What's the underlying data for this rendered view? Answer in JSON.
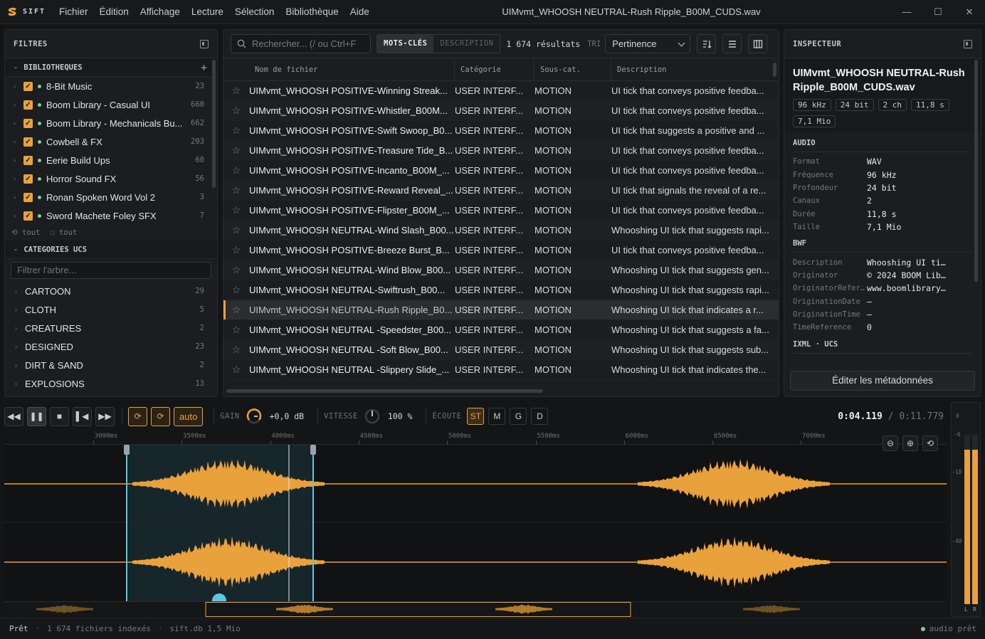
{
  "app": {
    "logo_text": "SIFT",
    "window_title": "UIMvmt_WHOOSH NEUTRAL-Rush Ripple_B00M_CUDS.wav",
    "accent": "#e9a13b"
  },
  "menus": [
    "Fichier",
    "Édition",
    "Affichage",
    "Lecture",
    "Sélection",
    "Bibliothèque",
    "Aide"
  ],
  "window_controls": {
    "minimize": "—",
    "maximize": "☐",
    "close": "✕"
  },
  "filters": {
    "title": "FILTRES",
    "libraries_title": "BIBLIOTHEQUES",
    "libraries": [
      {
        "name": "8-Bit Music",
        "count": "23"
      },
      {
        "name": "Boom Library - Casual UI",
        "count": "660"
      },
      {
        "name": "Boom Library - Mechanicals Bu...",
        "count": "662"
      },
      {
        "name": "Cowbell & FX",
        "count": "203"
      },
      {
        "name": "Eerie Build Ups",
        "count": "60"
      },
      {
        "name": "Horror Sound FX",
        "count": "56"
      },
      {
        "name": "Ronan Spoken Word Vol 2",
        "count": "3"
      },
      {
        "name": "Sword Machete Foley SFX",
        "count": "7"
      }
    ],
    "tout_a": "tout",
    "tout_b": "tout",
    "ucs_title": "CATEGORIES UCS",
    "ucs_placeholder": "Filtrer l'arbre...",
    "ucs": [
      {
        "name": "CARTOON",
        "count": "29"
      },
      {
        "name": "CLOTH",
        "count": "5"
      },
      {
        "name": "CREATURES",
        "count": "2"
      },
      {
        "name": "DESIGNED",
        "count": "23"
      },
      {
        "name": "DIRT & SAND",
        "count": "2"
      },
      {
        "name": "EXPLOSIONS",
        "count": "13"
      }
    ]
  },
  "search": {
    "placeholder": "Rechercher...  (/ ou Ctrl+F",
    "mode_keywords": "MOTS-CLÉS",
    "mode_description": "DESCRIPTION",
    "results": "1 674 résultats",
    "sort_label": "TRI",
    "sort_value": "Pertinence"
  },
  "table": {
    "headers": [
      "Nom de fichier",
      "Catégorie",
      "Sous-cat.",
      "Description"
    ],
    "rows": [
      {
        "name": "UIMvmt_WHOOSH POSITIVE-Winning Streak...",
        "cat": "USER INTERF...",
        "sub": "MOTION",
        "desc": "UI tick that conveys positive feedba..."
      },
      {
        "name": "UIMvmt_WHOOSH POSITIVE-Whistler_B00M...",
        "cat": "USER INTERF...",
        "sub": "MOTION",
        "desc": "UI tick that conveys positive feedba..."
      },
      {
        "name": "UIMvmt_WHOOSH POSITIVE-Swift Swoop_B0...",
        "cat": "USER INTERF...",
        "sub": "MOTION",
        "desc": "UI tick that suggests a positive and ..."
      },
      {
        "name": "UIMvmt_WHOOSH POSITIVE-Treasure Tide_B...",
        "cat": "USER INTERF...",
        "sub": "MOTION",
        "desc": "UI tick that conveys positive feedba..."
      },
      {
        "name": "UIMvmt_WHOOSH POSITIVE-Incanto_B00M_...",
        "cat": "USER INTERF...",
        "sub": "MOTION",
        "desc": "UI tick that conveys positive feedba..."
      },
      {
        "name": "UIMvmt_WHOOSH POSITIVE-Reward Reveal_...",
        "cat": "USER INTERF...",
        "sub": "MOTION",
        "desc": "UI tick that signals the reveal of a re..."
      },
      {
        "name": "UIMvmt_WHOOSH POSITIVE-Flipster_B00M_...",
        "cat": "USER INTERF...",
        "sub": "MOTION",
        "desc": "UI tick that conveys positive feedba..."
      },
      {
        "name": "UIMvmt_WHOOSH NEUTRAL-Wind Slash_B00...",
        "cat": "USER INTERF...",
        "sub": "MOTION",
        "desc": "Whooshing UI tick that suggests rapi..."
      },
      {
        "name": "UIMvmt_WHOOSH POSITIVE-Breeze Burst_B...",
        "cat": "USER INTERF...",
        "sub": "MOTION",
        "desc": "UI tick that conveys positive feedba..."
      },
      {
        "name": "UIMvmt_WHOOSH NEUTRAL-Wind Blow_B00...",
        "cat": "USER INTERF...",
        "sub": "MOTION",
        "desc": "Whooshing UI tick that suggests gen..."
      },
      {
        "name": "UIMvmt_WHOOSH NEUTRAL-Swiftrush_B00...",
        "cat": "USER INTERF...",
        "sub": "MOTION",
        "desc": "Whooshing UI tick that suggests rapi..."
      },
      {
        "name": "UIMvmt_WHOOSH NEUTRAL-Rush Ripple_B0...",
        "cat": "USER INTERF...",
        "sub": "MOTION",
        "desc": "Whooshing UI tick that indicates a r...",
        "selected": true
      },
      {
        "name": "UIMvmt_WHOOSH NEUTRAL -Speedster_B00...",
        "cat": "USER INTERF...",
        "sub": "MOTION",
        "desc": "Whooshing UI tick that suggests a fa..."
      },
      {
        "name": "UIMvmt_WHOOSH NEUTRAL -Soft Blow_B00...",
        "cat": "USER INTERF...",
        "sub": "MOTION",
        "desc": "Whooshing UI tick that suggests sub..."
      },
      {
        "name": "UIMvmt_WHOOSH NEUTRAL -Slippery Slide_...",
        "cat": "USER INTERF...",
        "sub": "MOTION",
        "desc": "Whooshing UI tick that indicates the..."
      }
    ]
  },
  "inspector": {
    "title": "INSPECTEUR",
    "filename": "UIMvmt_WHOOSH NEUTRAL-Rush Ripple_B00M_CUDS.wav",
    "tags": [
      "96 kHz",
      "24 bit",
      "2 ch",
      "11,8 s",
      "7,1 Mio"
    ],
    "audio_title": "AUDIO",
    "audio": [
      {
        "k": "Format",
        "v": "WAV"
      },
      {
        "k": "Fréquence",
        "v": "96 kHz"
      },
      {
        "k": "Profondeur",
        "v": "24 bit"
      },
      {
        "k": "Canaux",
        "v": "2"
      },
      {
        "k": "Durée",
        "v": "11,8 s"
      },
      {
        "k": "Taille",
        "v": "7,1 Mio"
      }
    ],
    "bwf_title": "BWF",
    "bwf": [
      {
        "k": "Description",
        "v": "Whooshing UI ti…"
      },
      {
        "k": "Originator",
        "v": "© 2024 BOOM Lib…"
      },
      {
        "k": "OriginatorRefer…",
        "v": "www.boomlibrary…"
      },
      {
        "k": "OriginationDate",
        "v": "—"
      },
      {
        "k": "OriginationTime",
        "v": "—"
      },
      {
        "k": "TimeReference",
        "v": "0"
      }
    ],
    "ixml_title": "IXML · UCS",
    "edit_button": "Éditer les métadonnées"
  },
  "transport": {
    "auto": "auto",
    "gain_label": "GAIN",
    "gain_value": "+0,0 dB",
    "speed_label": "VITESSE",
    "speed_value": "100 %",
    "monitor_label": "ÉCOUTE",
    "monitor_buttons": [
      "ST",
      "M",
      "G",
      "D"
    ],
    "time_current": "0:04.119",
    "time_sep": "/",
    "time_total": "0:11.779"
  },
  "ruler": {
    "ticks": [
      "3000ms",
      "3500ms",
      "4000ms",
      "4500ms",
      "5000ms",
      "5500ms",
      "6000ms",
      "6500ms",
      "7000ms"
    ]
  },
  "meter": {
    "labels": [
      "0",
      "-6",
      "-18",
      "-40"
    ],
    "channels": [
      "L",
      "R"
    ],
    "level_left": 0.91,
    "level_right": 0.91
  },
  "status": {
    "ready": "Prêt",
    "indexed": "1 674 fichiers indexés",
    "db": "sift.db 1,5 Mio",
    "audio": "audio prêt"
  }
}
